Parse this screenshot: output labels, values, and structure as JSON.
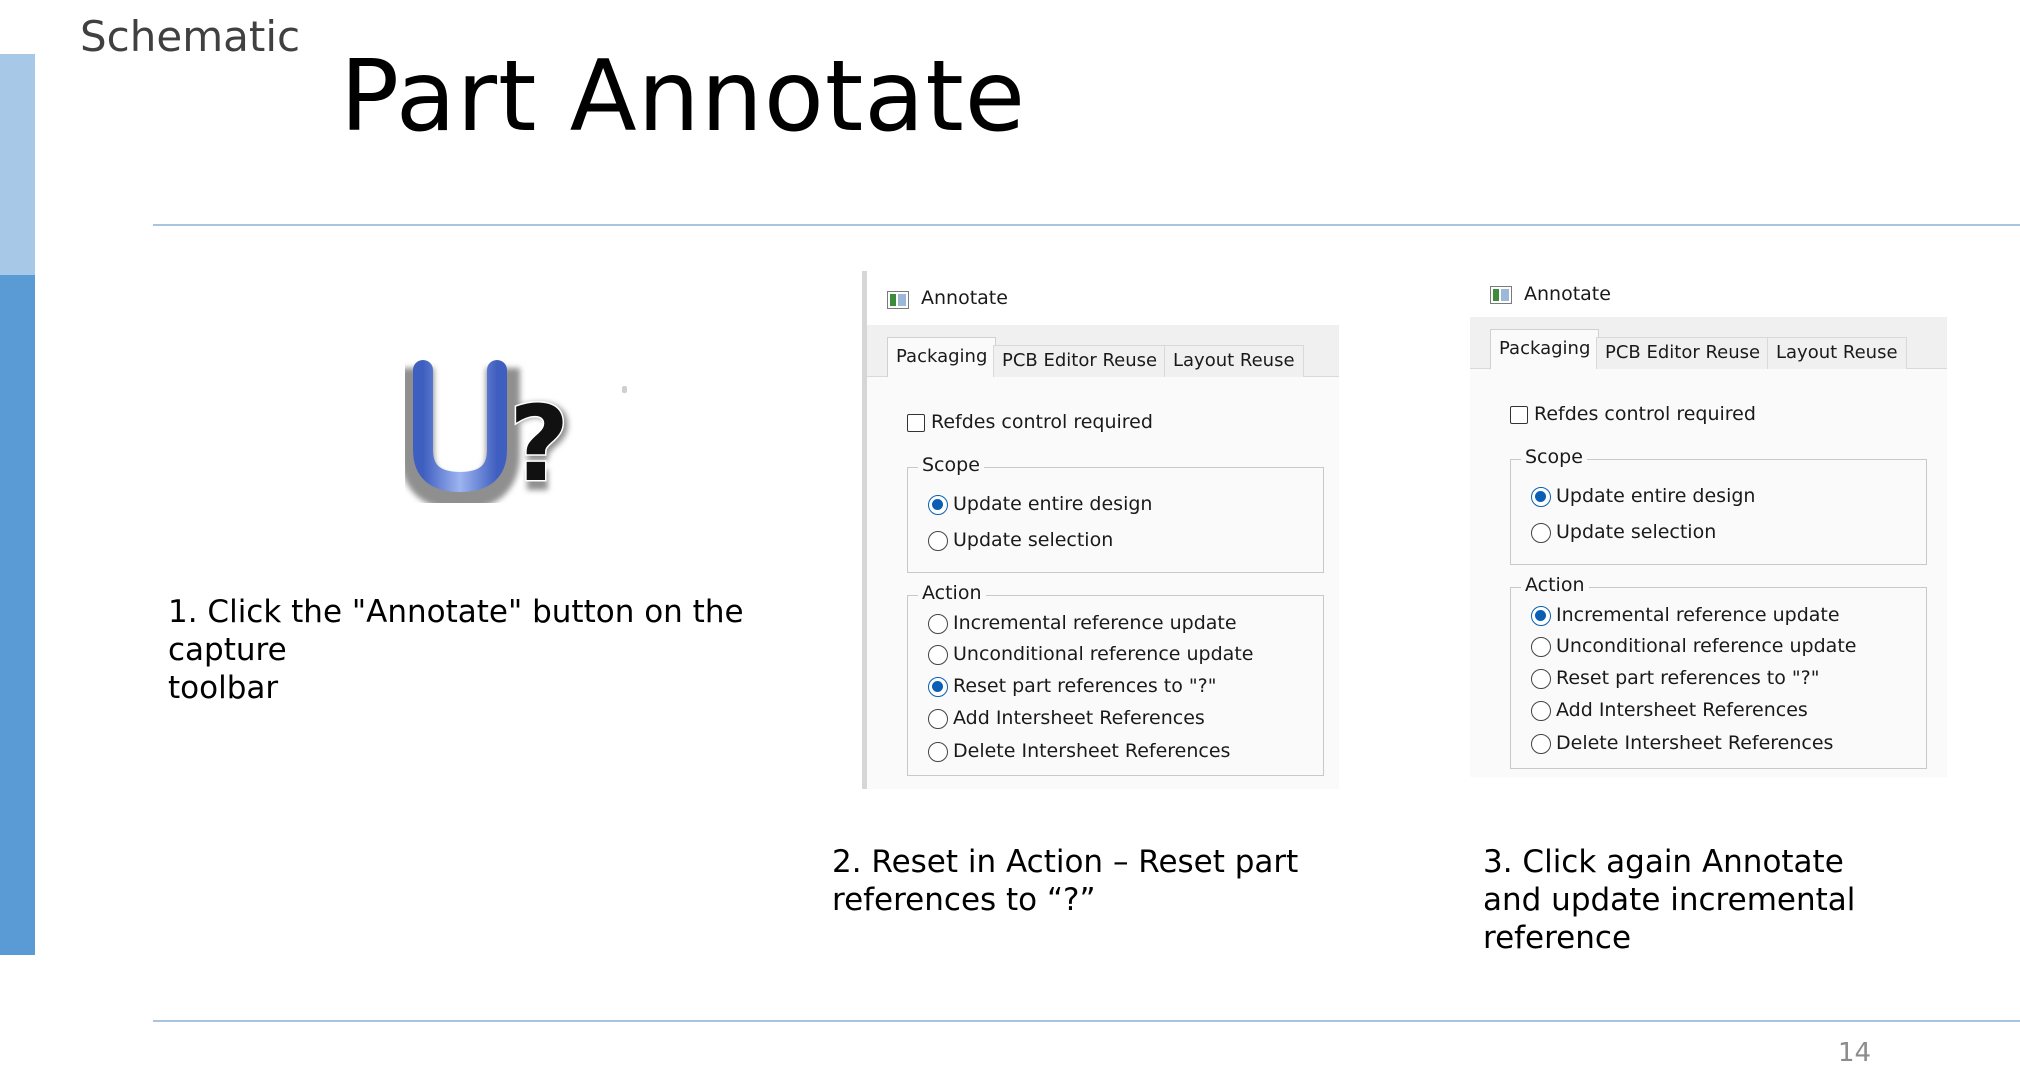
{
  "section_label": "Schematic",
  "title": "Part Annotate",
  "page_number": "14",
  "icon": {
    "name": "annotate-toolbar-icon",
    "letter": "U",
    "symbol": "?"
  },
  "steps": [
    {
      "line1": "1. Click the \"Annotate\" button on the capture",
      "line2": "toolbar"
    },
    {
      "line1": "2. Reset in Action – Reset part",
      "line2": "references to “?”"
    },
    {
      "line1": "3. Click again Annotate",
      "line2": "and update incremental reference"
    }
  ],
  "dialogs": [
    {
      "title": "Annotate",
      "tabs": [
        "Packaging",
        "PCB Editor Reuse",
        "Layout Reuse"
      ],
      "active_tab": "Packaging",
      "checkbox_label": "Refdes control required",
      "scope_legend": "Scope",
      "scope_options": [
        "Update entire design",
        "Update selection"
      ],
      "scope_selected": "Update entire design",
      "action_legend": "Action",
      "action_options": [
        "Incremental reference update",
        "Unconditional reference update",
        "Reset part references to \"?\"",
        "Add Intersheet References",
        "Delete Intersheet References"
      ],
      "action_selected": "Reset part references to \"?\""
    },
    {
      "title": "Annotate",
      "tabs": [
        "Packaging",
        "PCB Editor Reuse",
        "Layout Reuse"
      ],
      "active_tab": "Packaging",
      "checkbox_label": "Refdes control required",
      "scope_legend": "Scope",
      "scope_options": [
        "Update entire design",
        "Update selection"
      ],
      "scope_selected": "Update entire design",
      "action_legend": "Action",
      "action_options": [
        "Incremental reference update",
        "Unconditional reference update",
        "Reset part references to \"?\"",
        "Add Intersheet References",
        "Delete Intersheet References"
      ],
      "action_selected": "Incremental reference update"
    }
  ],
  "colors": {
    "accent_light": "#a8c8e8",
    "accent": "#5b9bd5",
    "radio_selected": "#0a5fb4"
  }
}
